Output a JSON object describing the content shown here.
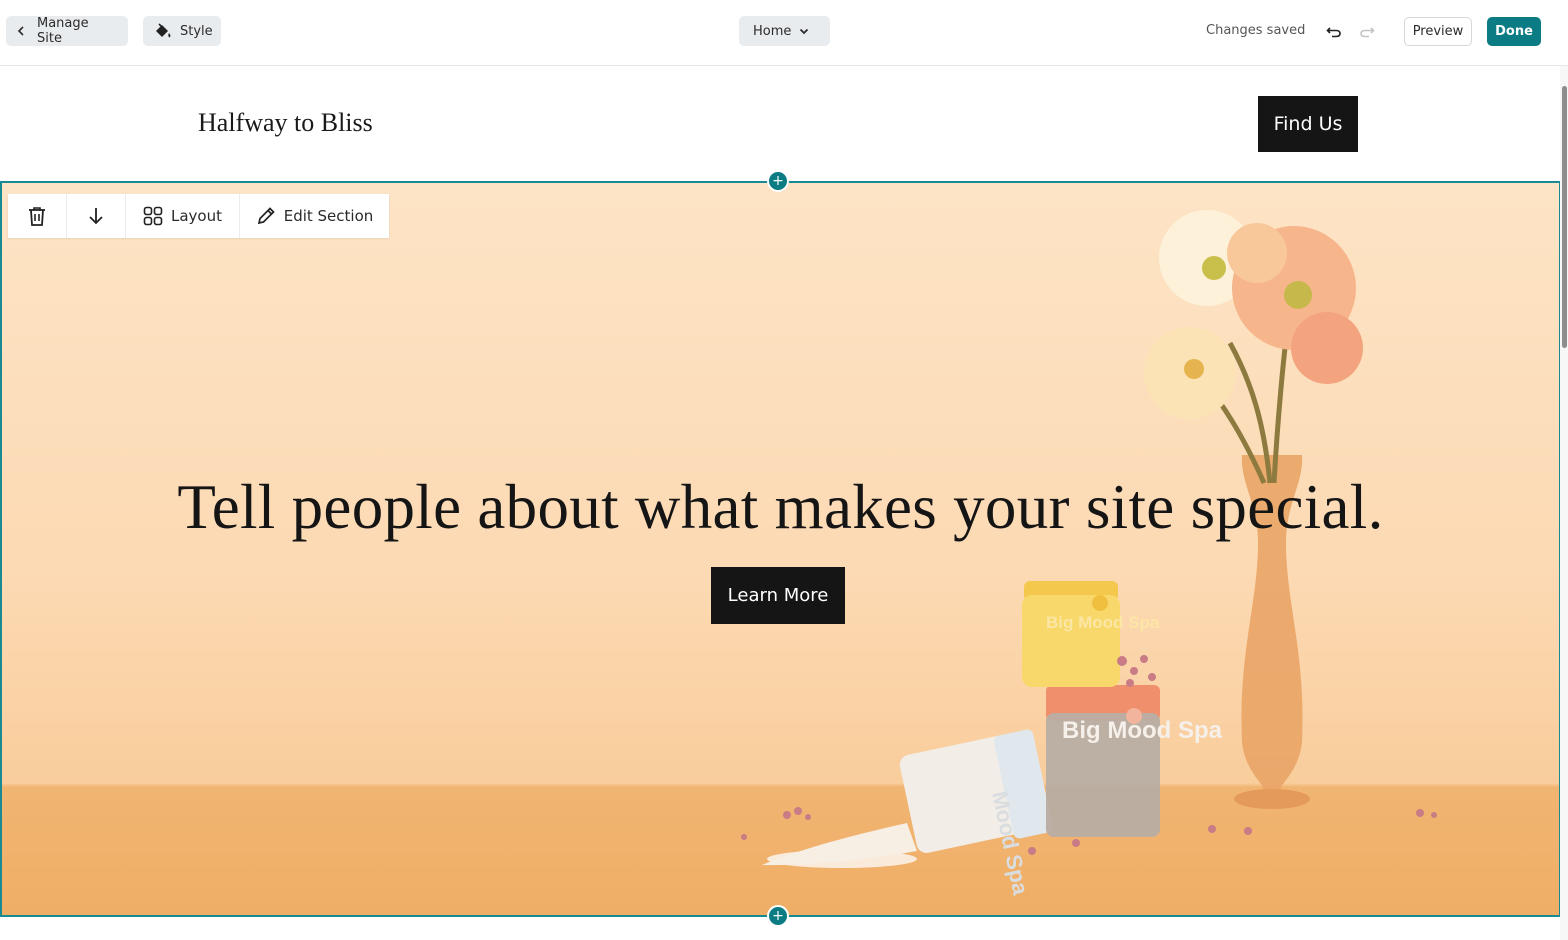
{
  "editor": {
    "manage_site_label": "Manage Site",
    "style_label": "Style",
    "page_selector": "Home",
    "status": "Changes saved",
    "preview_label": "Preview",
    "done_label": "Done",
    "accent_color": "#0b7c84"
  },
  "site": {
    "title": "Halfway to Bliss",
    "nav_button": "Find Us"
  },
  "section_toolbar": {
    "layout_label": "Layout",
    "edit_section_label": "Edit Section",
    "icons": [
      "trash-icon",
      "arrow-down-icon",
      "layout-grid-icon",
      "pencil-icon"
    ]
  },
  "hero": {
    "headline": "Tell people about what makes your site special.",
    "cta_label": "Learn More",
    "image": {
      "jar_top_label": "Big Mood Spa",
      "jar_middle_label": "Big Mood Spa",
      "jar_tipped_label": "Mood Spa"
    }
  },
  "add_section_symbol": "+"
}
